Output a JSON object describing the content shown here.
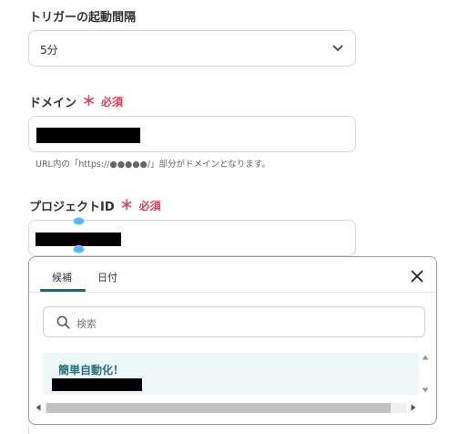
{
  "trigger_interval": {
    "label": "トリガーの起動間隔",
    "selected_value": "5分"
  },
  "domain": {
    "label": "ドメイン",
    "required_mark": "＊",
    "required_text": "必須",
    "hint": "URL内の「https://●●●●●/」部分がドメインとなります。"
  },
  "project_id": {
    "label": "プロジェクトID",
    "required_mark": "＊",
    "required_text": "必須"
  },
  "dropdown": {
    "tabs": [
      {
        "label": "候補",
        "active": true
      },
      {
        "label": "日付",
        "active": false
      }
    ],
    "search_placeholder": "検索",
    "items": [
      {
        "title": "簡単自動化！"
      }
    ],
    "horizontal_scroll_fraction": 0.95
  },
  "icons": {
    "select_chevron": "chevron-down-icon",
    "close": "close-icon",
    "search": "search-icon"
  },
  "colors": {
    "required": "#e0405a",
    "accent": "#1a6b7a",
    "item_text": "#2a6f7e",
    "item_bg": "#eef8f8"
  }
}
